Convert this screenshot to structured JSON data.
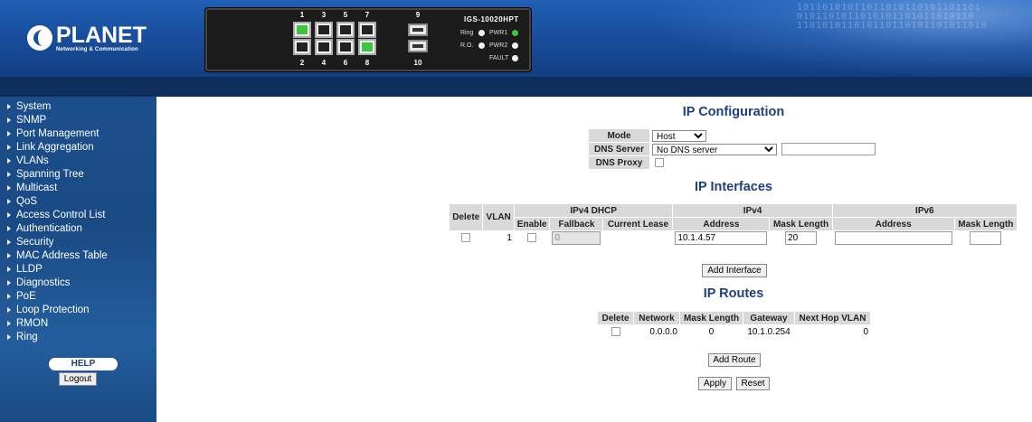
{
  "brand": {
    "logo_name": "PLANET",
    "logo_tagline": "Networking & Communication"
  },
  "device": {
    "model": "IGS-10020HPT",
    "ports_top": [
      "1",
      "3",
      "5",
      "7",
      "9"
    ],
    "ports_bottom": [
      "2",
      "4",
      "6",
      "8",
      "10"
    ],
    "active_ports": [
      "1",
      "8"
    ],
    "led_labels": [
      "Ring",
      "PWR1",
      "R.O.",
      "PWR2",
      "FAULT"
    ]
  },
  "sidebar": {
    "items": [
      "System",
      "SNMP",
      "Port Management",
      "Link Aggregation",
      "VLANs",
      "Spanning Tree",
      "Multicast",
      "QoS",
      "Access Control List",
      "Authentication",
      "Security",
      "MAC Address Table",
      "LLDP",
      "Diagnostics",
      "PoE",
      "Loop Protection",
      "RMON",
      "Ring"
    ],
    "help_label": "HELP",
    "logout_label": "Logout"
  },
  "ip_config": {
    "title": "IP Configuration",
    "mode_label": "Mode",
    "mode_value": "Host",
    "dns_server_label": "DNS Server",
    "dns_server_value": "No DNS server",
    "dns_server_input": "",
    "dns_proxy_label": "DNS Proxy"
  },
  "ip_interfaces": {
    "title": "IP Interfaces",
    "headers": {
      "delete": "Delete",
      "vlan": "VLAN",
      "ipv4_dhcp": "IPv4 DHCP",
      "ipv4": "IPv4",
      "ipv6": "IPv6",
      "enable": "Enable",
      "fallback": "Fallback",
      "current_lease": "Current Lease",
      "address": "Address",
      "mask_length": "Mask Length",
      "v6_address": "Address",
      "v6_mask_length": "Mask Length"
    },
    "row": {
      "vlan": "1",
      "fallback": "0",
      "current_lease": "",
      "ipv4_address": "10.1.4.57",
      "ipv4_mask": "20",
      "ipv6_address": "",
      "ipv6_mask": ""
    },
    "add_button": "Add Interface"
  },
  "ip_routes": {
    "title": "IP Routes",
    "headers": [
      "Delete",
      "Network",
      "Mask Length",
      "Gateway",
      "Next Hop VLAN"
    ],
    "row": {
      "network": "0.0.0.0",
      "mask_length": "0",
      "gateway": "10.1.0.254",
      "next_hop_vlan": "0"
    },
    "add_button": "Add Route"
  },
  "actions": {
    "apply": "Apply",
    "reset": "Reset"
  }
}
